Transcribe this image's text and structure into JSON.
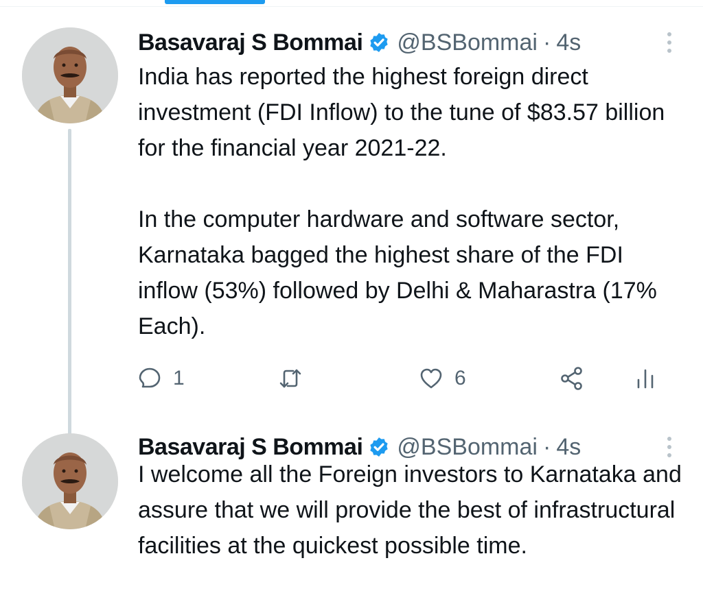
{
  "colors": {
    "accent": "#1d9bf0",
    "text_primary": "#0f1419",
    "text_secondary": "#536471",
    "thread_line": "#cfd9de"
  },
  "icons": {
    "verified": "verified-badge-icon",
    "more": "more-options-icon",
    "reply": "reply-icon",
    "retweet": "retweet-icon",
    "like": "heart-icon",
    "share": "share-icon",
    "analytics": "analytics-icon"
  },
  "tweets": [
    {
      "author": {
        "name": "Basavaraj S Bommai",
        "handle": "@BSBommai",
        "verified": true
      },
      "separator": "·",
      "time": "4s",
      "text": "India has reported the highest foreign direct investment (FDI Inflow) to the tune of $83.57 billion for the financial year 2021-22.\n\nIn the computer hardware and software sector, Karnataka bagged the highest share of the FDI inflow (53%) followed by Delhi & Maharastra (17% Each).",
      "replies": "1",
      "retweets": "",
      "likes": "6"
    },
    {
      "author": {
        "name": "Basavaraj S Bommai",
        "handle": "@BSBommai",
        "verified": true
      },
      "separator": "·",
      "time": "4s",
      "text": "I welcome all the Foreign investors to Karnataka and assure that we will provide the best of infrastructural facilities at the quickest possible time."
    }
  ]
}
